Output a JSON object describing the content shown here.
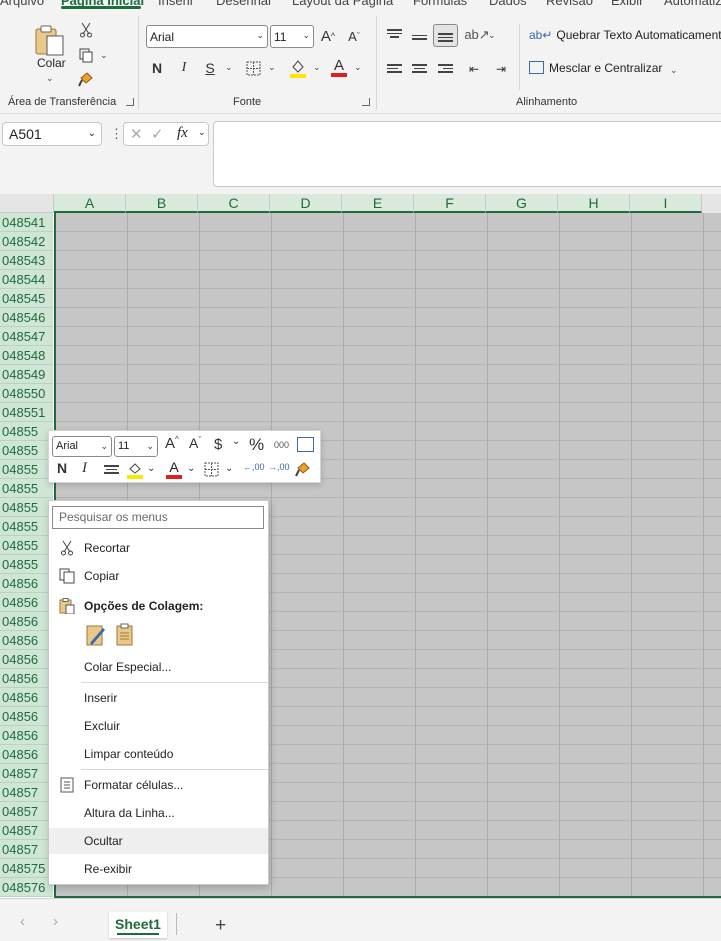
{
  "tabs": [
    "Arquivo",
    "Página Inicial",
    "Inserir",
    "Desenhar",
    "Layout da Página",
    "Fórmulas",
    "Dados",
    "Revisão",
    "Exibir",
    "Automatizar"
  ],
  "ribbon": {
    "paste_label": "Colar",
    "clipboard_label": "Área de Transferência",
    "font_label": "Fonte",
    "alignment_label": "Alinhamento",
    "font_name": "Arial",
    "font_size": "11",
    "wrap_text": "Quebrar Texto Automaticamente",
    "merge_center": "Mesclar e Centralizar",
    "bold": "N",
    "italic": "I",
    "underline": "S",
    "font_color": "A",
    "grow_font": "A",
    "shrink_font": "A"
  },
  "formula_bar": {
    "name_box": "A501",
    "fx": "fx",
    "formula": ""
  },
  "columns": [
    "A",
    "B",
    "C",
    "D",
    "E",
    "F",
    "G",
    "H",
    "I"
  ],
  "rows": [
    "048541",
    "048542",
    "048543",
    "048544",
    "048545",
    "048546",
    "048547",
    "048548",
    "048549",
    "048550",
    "048551",
    "04855",
    "04855",
    "04855",
    "04855",
    "04855",
    "04855",
    "04855",
    "04855",
    "04856",
    "04856",
    "04856",
    "04856",
    "04856",
    "04856",
    "04856",
    "04856",
    "04856",
    "04856",
    "04857",
    "04857",
    "04857",
    "04857",
    "04857",
    "048575",
    "048576"
  ],
  "minibar": {
    "font_name": "Arial",
    "font_size": "11",
    "currency": "$",
    "percent": "%",
    "thousands": "000",
    "bold": "N",
    "italic": "I",
    "font_color": "A",
    "inc_decimal": ",00",
    "dec_decimal": ",00"
  },
  "context_menu": {
    "search_placeholder": "Pesquisar os menus",
    "cut": "Recortar",
    "copy": "Copiar",
    "paste_options": "Opções de Colagem:",
    "paste_special": "Colar Especial...",
    "insert": "Inserir",
    "delete": "Excluir",
    "clear_contents": "Limpar conteúdo",
    "format_cells": "Formatar células...",
    "row_height": "Altura da Linha...",
    "hide": "Ocultar",
    "unhide": "Re-exibir"
  },
  "sheet": {
    "tab": "Sheet1",
    "add": "+"
  },
  "colors": {
    "accent": "#1e6c3c",
    "selection": "#c6c6c6",
    "highlight_yellow": "#ffe600",
    "font_red": "#e02020"
  }
}
